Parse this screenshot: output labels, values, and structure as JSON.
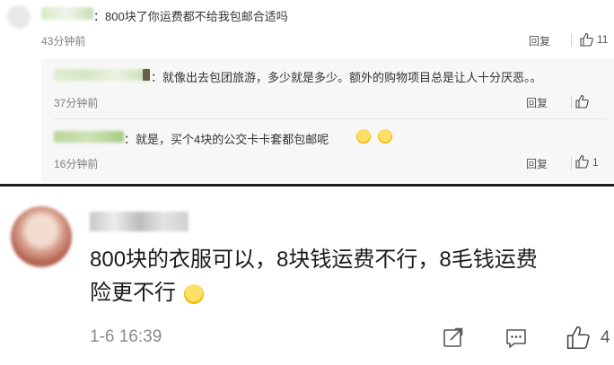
{
  "comment": {
    "text": "：800块了你运费都不给我包邮合适吗",
    "time": "43分钟前",
    "reply_label": "回复",
    "like_count": "11"
  },
  "replies": [
    {
      "text": "：就像出去包团旅游，多少就是多少。额外的购物项目总是让人十分厌恶。。",
      "time": "37分钟前",
      "reply_label": "回复",
      "like_count": ""
    },
    {
      "text": "：就是，买个4块的公交卡卡套都包邮呢",
      "time": "16分钟前",
      "reply_label": "回复",
      "like_count": "1"
    }
  ],
  "main_comment": {
    "line1": "800块的衣服可以，8块钱运费不行，8毛钱运费",
    "line2": "险更不行",
    "time": "1-6 16:39",
    "like_count": "4"
  },
  "colors": {
    "link_blur": "#b4d58e",
    "divider": "#1f1f1f",
    "reply_bg": "#f7f7f7"
  },
  "icons": [
    "thumbs-up-icon",
    "share-icon",
    "comment-icon",
    "emoji-icon"
  ]
}
